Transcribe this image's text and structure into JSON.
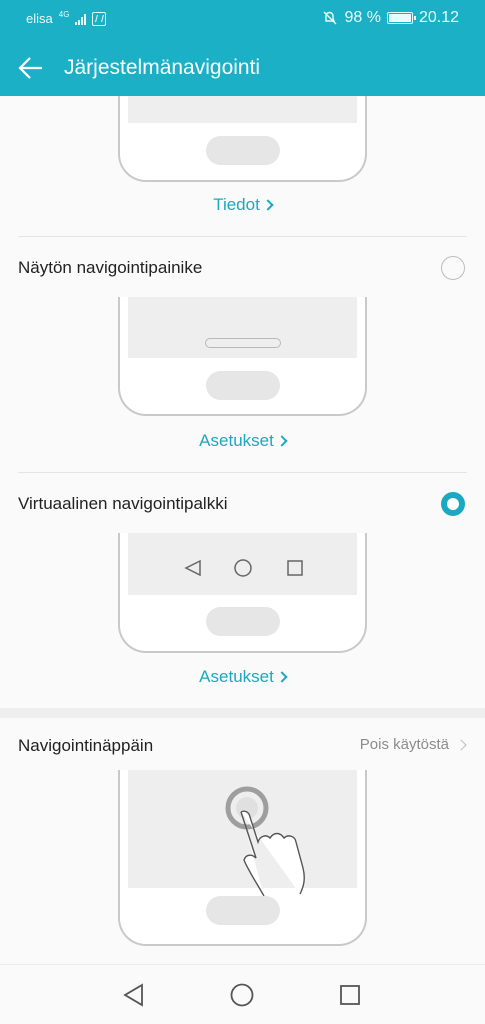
{
  "status_bar": {
    "carrier": "elisa",
    "network": "4G",
    "battery": "98 %",
    "time": "20.12"
  },
  "app_bar": {
    "title": "Järjestelmänavigointi"
  },
  "sections": {
    "gesture_link": "Tiedot",
    "three_key": {
      "label": "Näytön navigointipainike",
      "settings_link": "Asetukset",
      "selected": false
    },
    "virtual_bar": {
      "label": "Virtuaalinen navigointipalkki",
      "settings_link": "Asetukset",
      "selected": true
    },
    "nav_dock": {
      "label": "Navigointinäppäin",
      "status": "Pois käytöstä"
    }
  },
  "colors": {
    "accent": "#1aa9be",
    "header": "#1bb0c6"
  },
  "icons": [
    "back-arrow-icon",
    "circle-radio-icon",
    "triangle-back-icon",
    "circle-home-icon",
    "square-recents-icon",
    "hand-pointer-icon",
    "nfc-icon",
    "battery-icon",
    "signal-icon",
    "mute-icon"
  ]
}
